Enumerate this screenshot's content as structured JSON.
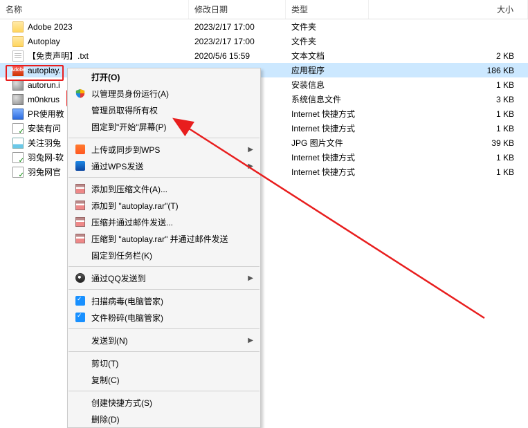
{
  "headers": {
    "name": "名称",
    "date": "修改日期",
    "type": "类型",
    "size": "大小"
  },
  "files": [
    {
      "icon": "ico-folder",
      "name": "Adobe 2023",
      "date": "2023/2/17 17:00",
      "type": "文件夹",
      "size": ""
    },
    {
      "icon": "ico-folder",
      "name": "Autoplay",
      "date": "2023/2/17 17:00",
      "type": "文件夹",
      "size": ""
    },
    {
      "icon": "ico-txt",
      "name": "【免责声明】.txt",
      "date": "2020/5/6 15:59",
      "type": "文本文档",
      "size": "2 KB"
    },
    {
      "icon": "ico-adobe",
      "name": "autoplay.",
      "date": "",
      "type": "应用程序",
      "size": "186 KB",
      "sel": true
    },
    {
      "icon": "ico-inf",
      "name": "autorun.i",
      "date": "",
      "type": "安装信息",
      "size": "1 KB"
    },
    {
      "icon": "ico-inf",
      "name": "m0nkrus",
      "date": "",
      "type": "系统信息文件",
      "size": "3 KB"
    },
    {
      "icon": "ico-doc",
      "name": "PR使用教",
      "date": "",
      "type": "Internet 快捷方式",
      "size": "1 KB"
    },
    {
      "icon": "ico-url",
      "name": "安装有问",
      "date": "",
      "type": "Internet 快捷方式",
      "size": "1 KB"
    },
    {
      "icon": "ico-jpg",
      "name": "关注羽兔",
      "date": "",
      "type": "JPG 图片文件",
      "size": "39 KB"
    },
    {
      "icon": "ico-url",
      "name": "羽兔网-软",
      "date": "",
      "type": "Internet 快捷方式",
      "size": "1 KB"
    },
    {
      "icon": "ico-url",
      "name": "羽兔网官",
      "date": "",
      "type": "Internet 快捷方式",
      "size": "1 KB"
    }
  ],
  "menu": {
    "open": "打开(O)",
    "runadmin": "以管理员身份运行(A)",
    "takeown": "管理员取得所有权",
    "pinstart": "固定到\"开始\"屏幕(P)",
    "wpsup": "上传或同步到WPS",
    "wpssend": "通过WPS发送",
    "addarch": "添加到压缩文件(A)...",
    "addrar": "添加到 \"autoplay.rar\"(T)",
    "ziemail": "压缩并通过邮件发送...",
    "zraremail": "压缩到 \"autoplay.rar\" 并通过邮件发送",
    "pintask": "固定到任务栏(K)",
    "qqsend": "通过QQ发送到",
    "scan": "扫描病毒(电脑管家)",
    "shred": "文件粉碎(电脑管家)",
    "sendto": "发送到(N)",
    "cut": "剪切(T)",
    "copy": "复制(C)",
    "shortcut": "创建快捷方式(S)",
    "delete": "删除(D)"
  }
}
